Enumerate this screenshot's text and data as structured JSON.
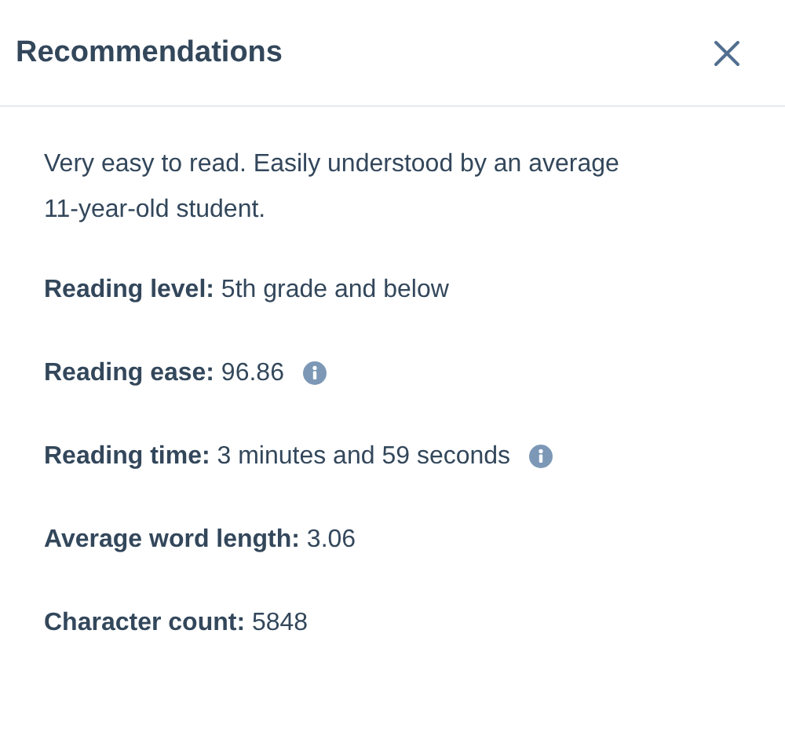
{
  "panel": {
    "title": "Recommendations"
  },
  "description": "Very easy to read. Easily understood by an average 11-year-old student.",
  "stats": [
    {
      "label": "Reading level:",
      "value": "5th grade and below",
      "info": false
    },
    {
      "label": "Reading ease:",
      "value": "96.86",
      "info": true
    },
    {
      "label": "Reading time:",
      "value": "3 minutes and 59 seconds",
      "info": true
    },
    {
      "label": "Average word length:",
      "value": "3.06",
      "info": false
    },
    {
      "label": "Character count:",
      "value": "5848",
      "info": false
    }
  ]
}
